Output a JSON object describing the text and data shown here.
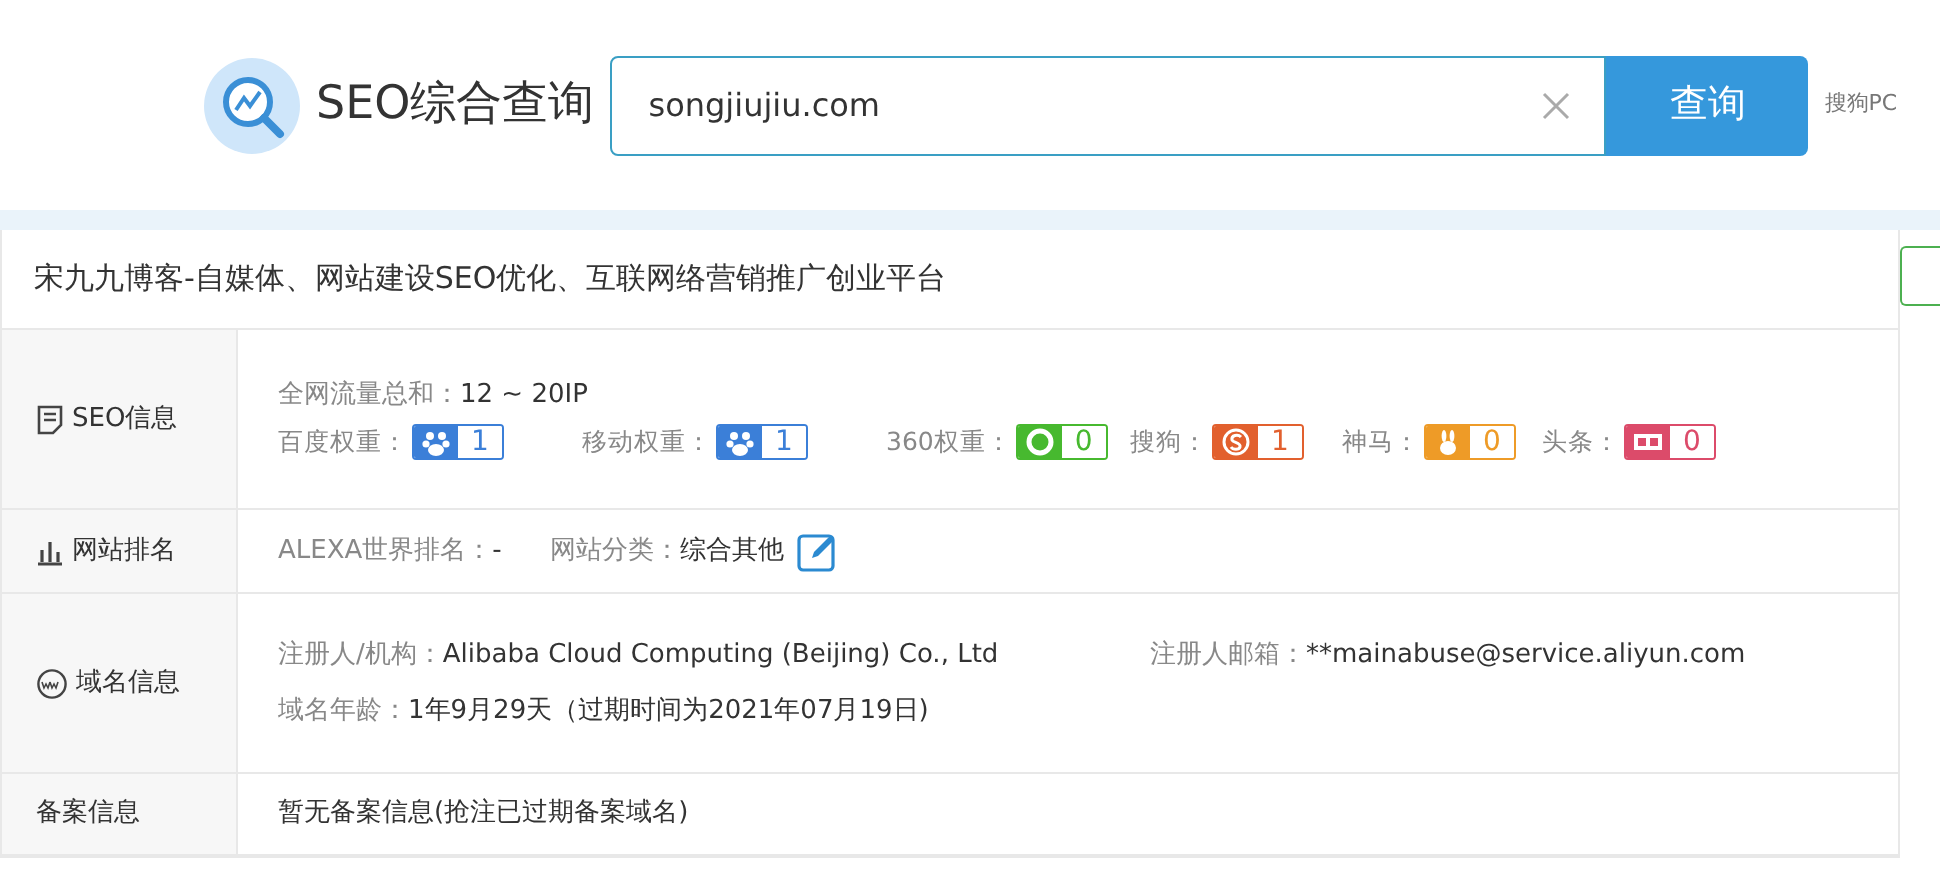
{
  "header": {
    "title": "SEO综合查询",
    "search": {
      "value": "songjiujiu.com"
    },
    "search_button": "查询",
    "side_link": "搜狗PC"
  },
  "site_title": "宋九九博客-自媒体、网站建设SEO优化、互联网络营销推广创业平台",
  "sections": [
    {
      "kind": "seo",
      "label": "SEO信息",
      "traffic": {
        "label": "全网流量总和：",
        "value": "12 ~ 20IP"
      },
      "weights": [
        {
          "label": "百度权重：",
          "kind": "baidu",
          "color": "#3b7fd8",
          "value": "1"
        },
        {
          "label": "移动权重：",
          "kind": "mobile",
          "color": "#3b7fd8",
          "value": "1"
        },
        {
          "label": "360权重：",
          "kind": "qihoo",
          "color": "#47b92f",
          "value": "0"
        },
        {
          "label": "搜狗：",
          "kind": "sogou",
          "color": "#e2602e",
          "value": "1"
        },
        {
          "label": "神马：",
          "kind": "shenma",
          "color": "#ee9b27",
          "value": "0"
        },
        {
          "label": "头条：",
          "kind": "toutiao",
          "color": "#dc4b6a",
          "value": "0"
        }
      ]
    },
    {
      "kind": "rank",
      "label": "网站排名",
      "fields": [
        {
          "label": "ALEXA世界排名：",
          "value": "-"
        },
        {
          "label": "网站分类：",
          "value": "综合其他"
        }
      ]
    },
    {
      "kind": "domain",
      "label": "域名信息",
      "lines": [
        [
          {
            "label": "注册人/机构：",
            "value": "Alibaba Cloud Computing (Beijing) Co., Ltd"
          },
          {
            "label": "注册人邮箱：",
            "value": "**mainabuse@service.aliyun.com"
          }
        ],
        [
          {
            "label": "域名年龄：",
            "value": "1年9月29天（过期时间为2021年07月19日)"
          }
        ]
      ]
    },
    {
      "kind": "record",
      "label": "备案信息",
      "text": "暂无备案信息(抢注已过期备案域名)"
    }
  ]
}
